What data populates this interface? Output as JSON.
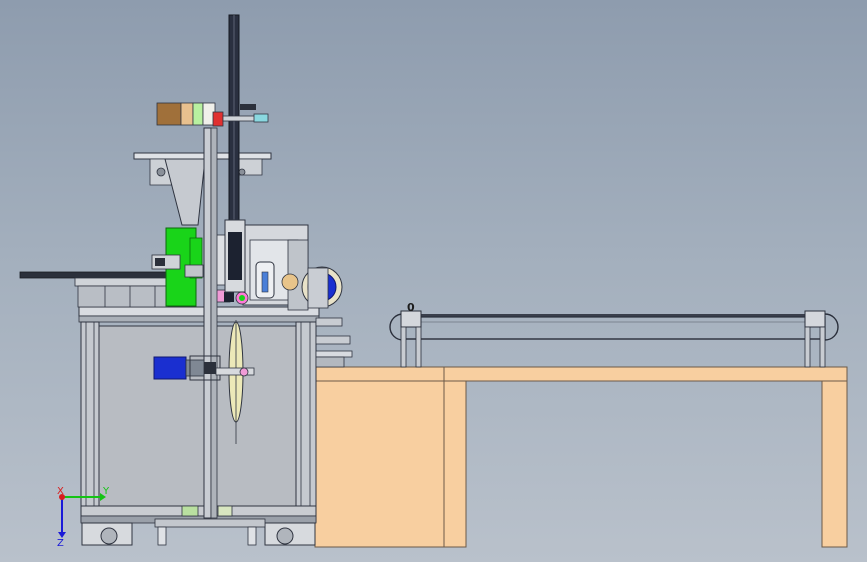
{
  "scene": {
    "colors": {
      "frame": "#2f3440",
      "frame_light": "#c7ccd3",
      "panel": "#b8bcc2",
      "table": "#f8cfa0",
      "table_edge": "#6b5a48",
      "green": "#19d419",
      "blue_motor": "#1a2fd0",
      "belt_dark": "#1c2230",
      "warm_stripe": "#e8c08e"
    }
  },
  "conveyor": {
    "label": "0"
  },
  "triad": {
    "x_label": "X",
    "y_label": "Y",
    "z_label": "Z",
    "x_color": "#d81d1d",
    "y_color": "#14c414",
    "z_color": "#1a1ad8"
  }
}
